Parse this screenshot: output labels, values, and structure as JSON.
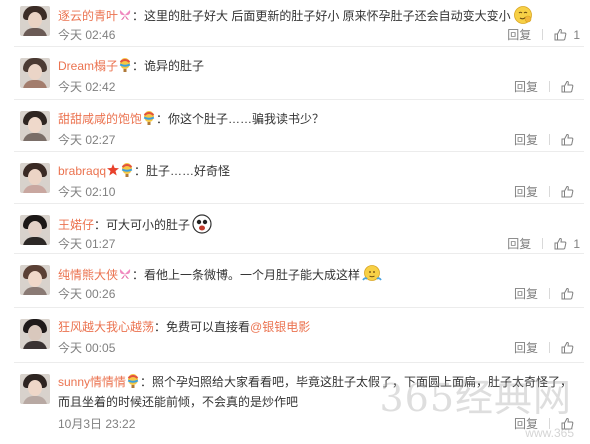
{
  "comments": [
    {
      "user": "逐云的青叶",
      "badges": [
        "butterfly-badge"
      ],
      "text": "：这里的肚子好大  后面更新的肚子好小  原来怀孕肚子还会自动变大变小",
      "emoji": "smirk-emoji",
      "time": "今天 02:46",
      "reply_label": "回复",
      "likes": "1"
    },
    {
      "user": "Dream榻子",
      "badges": [
        "balloon-badge"
      ],
      "text": "：诡异的肚子",
      "time": "今天 02:42",
      "reply_label": "回复",
      "likes": ""
    },
    {
      "user": "甜甜咸咸的饱饱",
      "badges": [
        "balloon-badge"
      ],
      "text": "：你这个肚子……骗我读书少？",
      "time": "今天 02:27",
      "reply_label": "回复",
      "likes": ""
    },
    {
      "user": "brabraqq",
      "badges": [
        "star-badge",
        "balloon-badge"
      ],
      "text": "：肚子……好奇怪",
      "time": "今天 02:10",
      "reply_label": "回复",
      "likes": ""
    },
    {
      "user": "王婼仔",
      "badges": [],
      "text": "：可大可小的肚子",
      "emoji": "shocked-emoji",
      "time": "今天 01:27",
      "reply_label": "回复",
      "likes": "1"
    },
    {
      "user": "纯情熊大侠",
      "badges": [
        "butterfly-badge"
      ],
      "text": "：看他上一条微博。一个月肚子能大成这样",
      "emoji": "shrug-emoji",
      "time": "今天 00:26",
      "reply_label": "回复",
      "likes": ""
    },
    {
      "user": "狂风越大我心越荡",
      "badges": [],
      "text": "：免费可以直接看",
      "mention": "@银银电影",
      "time": "今天 00:05",
      "reply_label": "回复",
      "likes": ""
    },
    {
      "user": "sunny情情情",
      "badges": [
        "balloon-badge"
      ],
      "text": "：照个孕妇照给大家看看吧，毕竟这肚子太假了，下面圆上面扁，肚子太奇怪了，",
      "text2": "而且坐着的时候还能前倾，不会真的是炒作吧",
      "time": "10月3日 23:22",
      "reply_label": "回复",
      "likes": ""
    }
  ],
  "watermark": {
    "text": "365经典网",
    "url": "www.365"
  },
  "colors": {
    "username": "#eb7350",
    "text": "#333333",
    "meta": "#808080",
    "divider": "#ececec"
  }
}
